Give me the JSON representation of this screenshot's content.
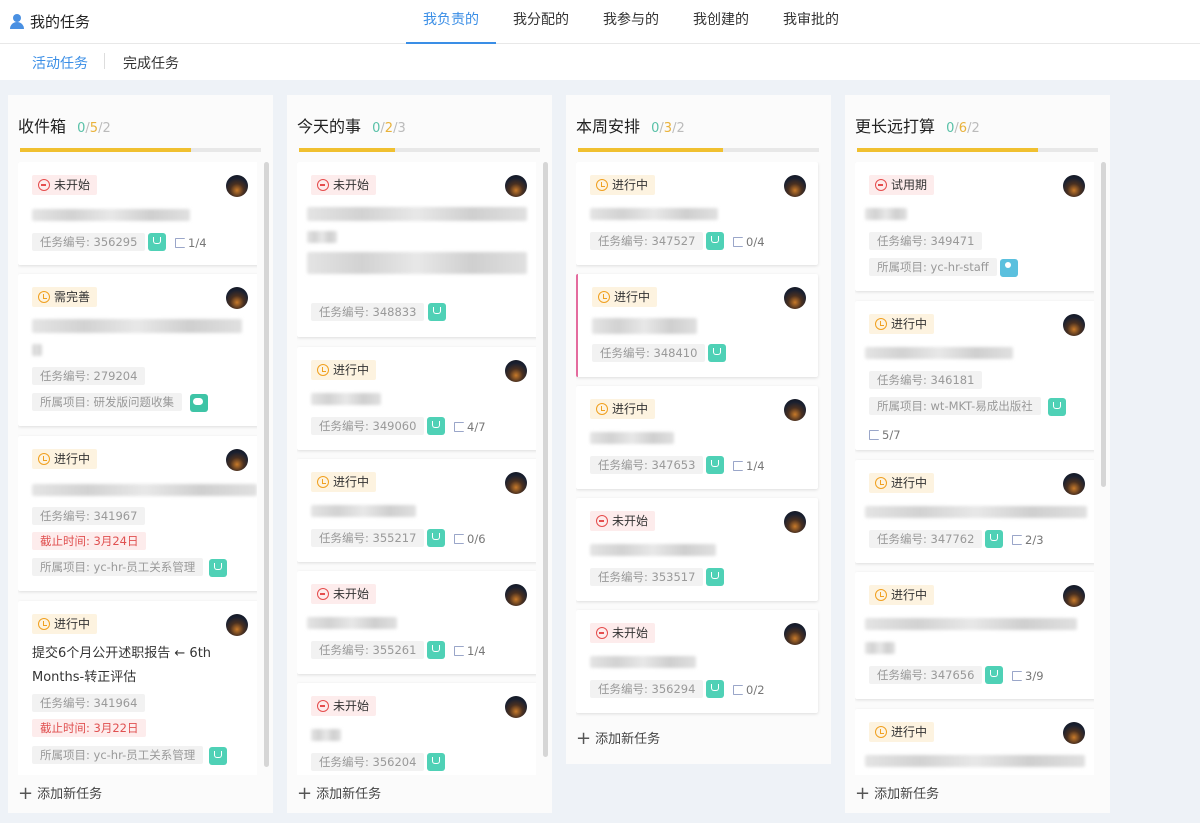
{
  "header": {
    "title": "我的任务",
    "tabs": [
      "我负责的",
      "我分配的",
      "我参与的",
      "我创建的",
      "我审批的"
    ],
    "active_tab": 0
  },
  "subtabs": [
    "活动任务",
    "完成任务"
  ],
  "columns": [
    {
      "title": "收件箱",
      "c1": "0",
      "c2": "5",
      "c3": "2",
      "progress": 0.71,
      "add": "添加新任务"
    },
    {
      "title": "今天的事",
      "c1": "0",
      "c2": "2",
      "c3": "3",
      "progress": 0.4,
      "add": "添加新任务"
    },
    {
      "title": "本周安排",
      "c1": "0",
      "c2": "3",
      "c3": "2",
      "progress": 0.6,
      "add": "添加新任务"
    },
    {
      "title": "更长远打算",
      "c1": "0",
      "c2": "6",
      "c3": "2",
      "progress": 0.75,
      "add": "添加新任务"
    }
  ],
  "cards": {
    "c0": [
      {
        "status": "未开始",
        "id": "任务编号: 356295",
        "subtasks": "1/4"
      },
      {
        "status": "需完善",
        "id": "任务编号: 279204",
        "project": "所属项目: 研发版问题收集"
      },
      {
        "status": "进行中",
        "id": "任务编号: 341967",
        "deadline": "截止时间: 3月24日",
        "project": "所属项目: yc-hr-员工关系管理"
      },
      {
        "status": "进行中",
        "title": "提交6个月公开述职报告 ← 6th Months-转正评估",
        "id": "任务编号: 341964",
        "deadline": "截止时间: 3月22日",
        "project": "所属项目: yc-hr-员工关系管理"
      }
    ],
    "c1": [
      {
        "status": "未开始",
        "id": "任务编号: 348833"
      },
      {
        "status": "进行中",
        "id": "任务编号: 349060",
        "subtasks": "4/7"
      },
      {
        "status": "进行中",
        "id": "任务编号: 355217",
        "subtasks": "0/6"
      },
      {
        "status": "未开始",
        "id": "任务编号: 355261",
        "subtasks": "1/4"
      },
      {
        "status": "未开始",
        "id": "任务编号: 356204"
      }
    ],
    "c2": [
      {
        "status": "进行中",
        "id": "任务编号: 347527",
        "subtasks": "0/4"
      },
      {
        "status": "进行中",
        "id": "任务编号: 348410"
      },
      {
        "status": "进行中",
        "id": "任务编号: 347653",
        "subtasks": "1/4"
      },
      {
        "status": "未开始",
        "id": "任务编号: 353517"
      },
      {
        "status": "未开始",
        "id": "任务编号: 356294",
        "subtasks": "0/2"
      }
    ],
    "c3": [
      {
        "status": "试用期",
        "id": "任务编号: 349471",
        "project": "所属项目: yc-hr-staff"
      },
      {
        "status": "进行中",
        "id": "任务编号: 346181",
        "project": "所属项目: wt-MKT-易成出版社",
        "subtasks": "5/7"
      },
      {
        "status": "进行中",
        "id": "任务编号: 347762",
        "subtasks": "2/3"
      },
      {
        "status": "进行中",
        "id": "任务编号: 347656",
        "subtasks": "3/9"
      },
      {
        "status": "进行中"
      }
    ]
  },
  "colors": {
    "accent": "#3a8ee6",
    "progress": "#f0c030",
    "icon": "#4fd1b6",
    "deadline": "#e05050"
  }
}
